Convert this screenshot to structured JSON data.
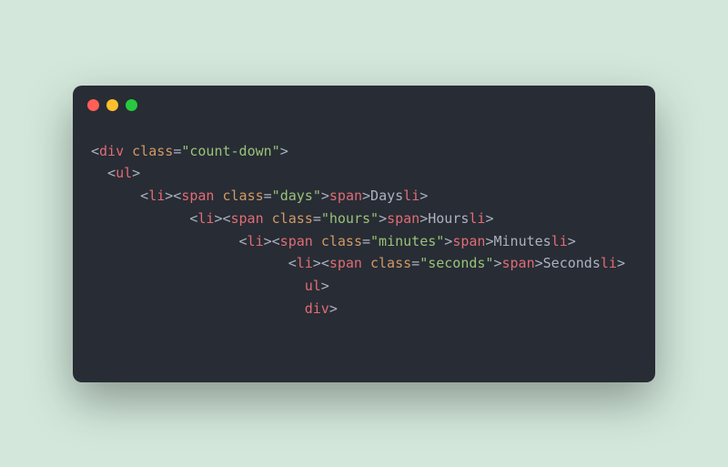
{
  "wrapperTag": "div",
  "wrapperAttrName": "class",
  "wrapperAttrValue": "\"count-down\"",
  "listTag": "ul",
  "items": [
    {
      "tag": "li",
      "innerTag": "span",
      "attrName": "class",
      "attrValue": "\"days\"",
      "text": "Days"
    },
    {
      "tag": "li",
      "innerTag": "span",
      "attrName": "class",
      "attrValue": "\"hours\"",
      "text": "Hours"
    },
    {
      "tag": "li",
      "innerTag": "span",
      "attrName": "class",
      "attrValue": "\"minutes\"",
      "text": "Minutes"
    },
    {
      "tag": "li",
      "innerTag": "span",
      "attrName": "class",
      "attrValue": "\"seconds\"",
      "text": "Seconds"
    }
  ],
  "punct": {
    "open": "<",
    "close": ">",
    "openSlash": "</",
    "selfClose": ">",
    "eq": "=",
    "space": " "
  }
}
